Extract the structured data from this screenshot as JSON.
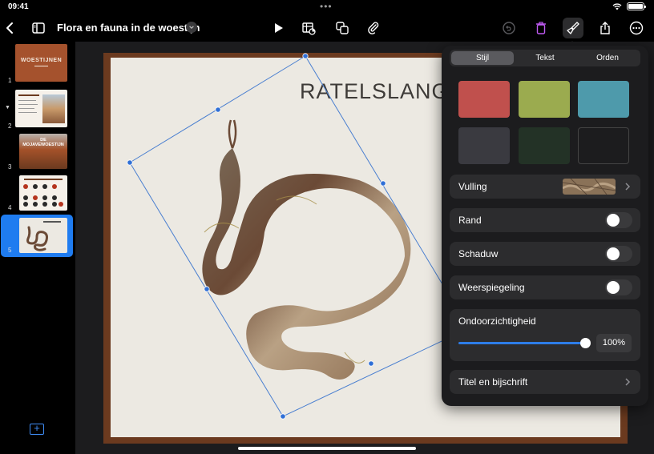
{
  "status_bar": {
    "time": "09:41",
    "dots": "•••"
  },
  "toolbar": {
    "document_title": "Flora en fauna in de woestijn",
    "icons": [
      "back-icon",
      "sidebar-icon",
      "play-icon",
      "table-chart-icon",
      "shapes-icon",
      "paperclip-icon",
      "undo-icon",
      "trash-icon",
      "paintbrush-icon",
      "share-icon",
      "more-icon"
    ],
    "accent_color": "#bf5af2"
  },
  "navigator": {
    "slides": [
      {
        "number": "1",
        "title": "WOESTIJNEN"
      },
      {
        "number": "2",
        "title": ""
      },
      {
        "number": "3",
        "title": "DE MOJAVEWOESTIJN"
      },
      {
        "number": "4",
        "title": ""
      },
      {
        "number": "5",
        "title": "",
        "selected": true
      }
    ],
    "selected_color": "#1f7cf0"
  },
  "slide": {
    "title": "RATELSLANG"
  },
  "format_panel": {
    "tabs": [
      {
        "label": "Stijl",
        "active": true
      },
      {
        "label": "Tekst",
        "active": false
      },
      {
        "label": "Orden",
        "active": false
      }
    ],
    "swatch_colors": [
      "#c0504d",
      "#9bab4f",
      "#4e9aab",
      "#3a3a40",
      "#233226",
      "#1c1c1e"
    ],
    "fill_label": "Vulling",
    "border_label": "Rand",
    "shadow_label": "Schaduw",
    "reflection_label": "Weerspiegeling",
    "opacity_label": "Ondoorzichtigheid",
    "opacity_value": "100%",
    "opacity_fraction": 1.0,
    "caption_label": "Titel en bijschrift",
    "toggles": {
      "border": false,
      "shadow": false,
      "reflection": false
    }
  }
}
